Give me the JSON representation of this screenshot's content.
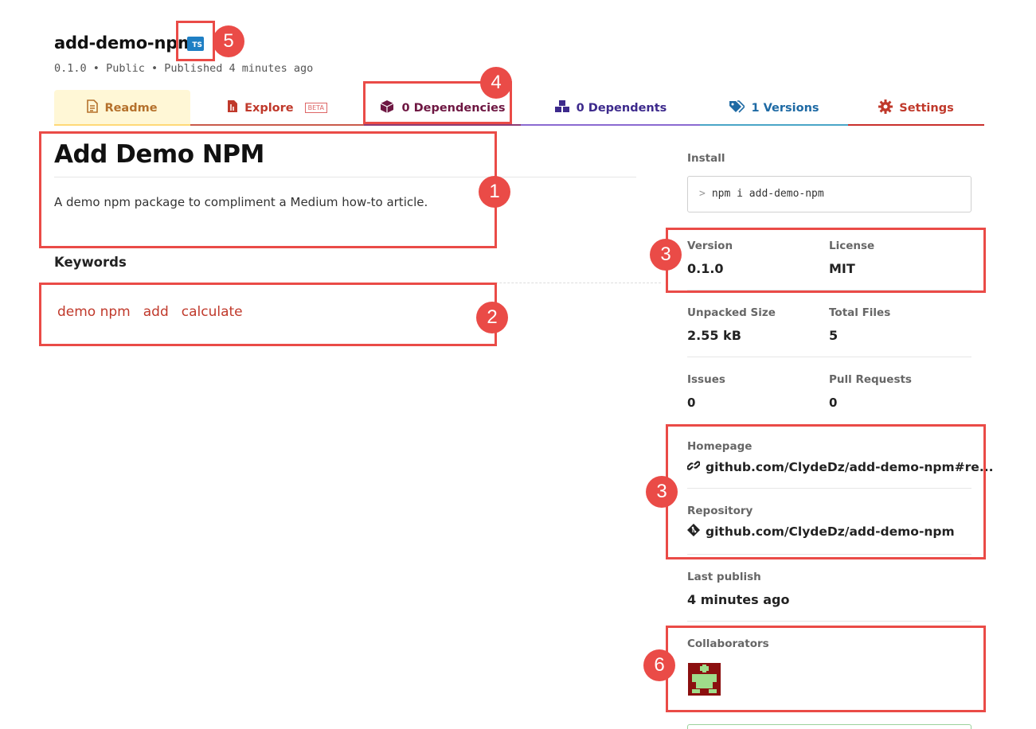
{
  "header": {
    "package_name": "add-demo-npm",
    "ts_badge": "TS",
    "version": "0.1.0",
    "separator": "•",
    "visibility": "Public",
    "published": "Published 4 minutes ago"
  },
  "tabs": [
    {
      "label": "Readme",
      "icon": "readme-icon"
    },
    {
      "label": "Explore",
      "icon": "explore-icon",
      "badge": "BETA"
    },
    {
      "label": "0 Dependencies",
      "icon": "box-icon"
    },
    {
      "label": "0 Dependents",
      "icon": "boxes-icon"
    },
    {
      "label": "1 Versions",
      "icon": "tags-icon"
    },
    {
      "label": "Settings",
      "icon": "gear-icon"
    }
  ],
  "readme": {
    "title": "Add Demo NPM",
    "description": "A demo npm package to compliment a Medium how-to article.",
    "keywords_title": "Keywords",
    "keywords": [
      "demo npm",
      "add",
      "calculate"
    ]
  },
  "sidebar": {
    "install_label": "Install",
    "install_prompt": ">",
    "install_command": "npm i add-demo-npm",
    "version_label": "Version",
    "version_value": "0.1.0",
    "license_label": "License",
    "license_value": "MIT",
    "unpacked_label": "Unpacked Size",
    "unpacked_value": "2.55 kB",
    "files_label": "Total Files",
    "files_value": "5",
    "issues_label": "Issues",
    "issues_value": "0",
    "pr_label": "Pull Requests",
    "pr_value": "0",
    "homepage_label": "Homepage",
    "homepage_value": "github.com/ClydeDz/add-demo-npm#re...",
    "repository_label": "Repository",
    "repository_value": "github.com/ClydeDz/add-demo-npm",
    "last_publish_label": "Last publish",
    "last_publish_value": "4 minutes ago",
    "collaborators_label": "Collaborators"
  },
  "callouts": [
    "1",
    "2",
    "3",
    "4",
    "5",
    "3",
    "6"
  ],
  "colors": {
    "callout": "#ea4b47",
    "keyword": "#c0392b",
    "readme_tab_bg": "#fff7d6"
  }
}
